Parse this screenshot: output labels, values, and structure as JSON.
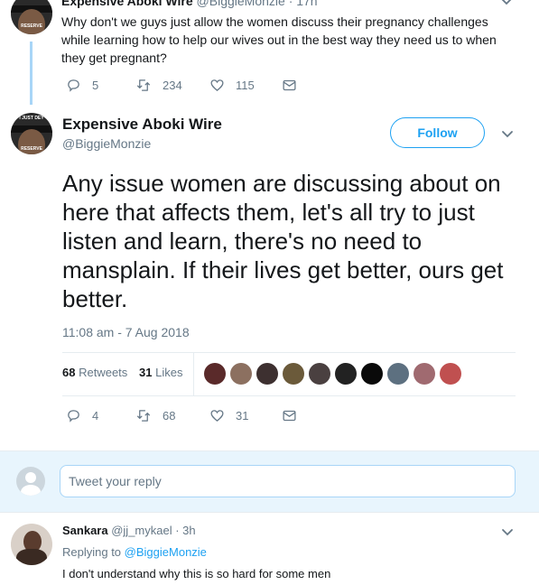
{
  "parent_tweet": {
    "name": "Expensive Aboki Wire",
    "handle": "@BiggieMonzie",
    "time": "· 17h",
    "text": "Why don't we guys just allow the women discuss their pregnancy challenges while learning how to help our wives out in the best way they need us to when they get pregnant?",
    "replies": "5",
    "retweets": "234",
    "likes": "115"
  },
  "main_tweet": {
    "name": "Expensive Aboki Wire",
    "handle": "@BiggieMonzie",
    "follow_label": "Follow",
    "text": "Any issue women are discussing about on here that affects them, let's all try to just listen and learn, there's no need to mansplain. If their lives get better, ours get better.",
    "timestamp": "11:08 am - 7 Aug 2018",
    "retweets_count": "68",
    "retweets_label": "Retweets",
    "likes_count": "31",
    "likes_label": "Likes",
    "replies": "4",
    "retweets": "68",
    "likes": "31"
  },
  "compose": {
    "placeholder": "Tweet your reply"
  },
  "reply_tweet": {
    "name": "Sankara",
    "handle": "@jj_mykael",
    "time": "· 3h",
    "replying_prefix": "Replying to",
    "replying_to": "@BiggieMonzie",
    "text": "I don't understand why this is so hard for some men"
  },
  "colors": {
    "accent": "#1da1f2",
    "muted": "#657786",
    "border": "#e6ecf0",
    "compose_bg": "#f5f8fa"
  }
}
